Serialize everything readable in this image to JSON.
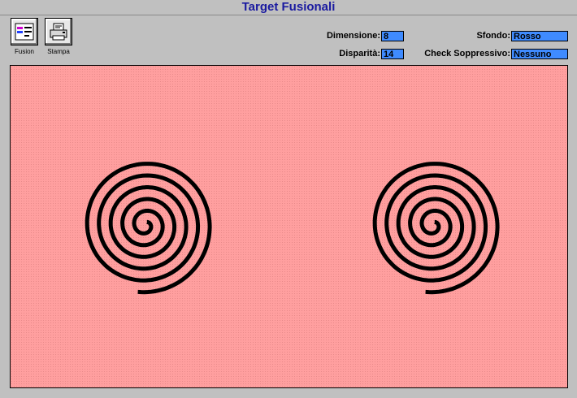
{
  "window": {
    "title": "Target Fusionali"
  },
  "toolbar": {
    "fusion_label": "Fusion",
    "stampa_label": "Stampa"
  },
  "settings": {
    "dimensione": {
      "label": "Dimensione:",
      "value": "8"
    },
    "disparita": {
      "label": "Disparità:",
      "value": "14"
    },
    "sfondo": {
      "label": "Sfondo:",
      "value": "Rosso"
    },
    "check": {
      "label": "Check Soppressivo:",
      "value": "Nessuno"
    }
  },
  "colors": {
    "background": "#ff9f9f",
    "spiral": "#000000",
    "field": "#3f8bff",
    "title": "#1a1aa0"
  },
  "icons": {
    "fusion": "fusion-target-icon",
    "stampa": "printer-icon"
  }
}
